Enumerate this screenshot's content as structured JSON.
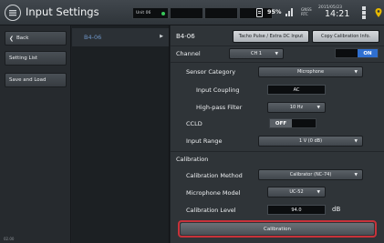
{
  "header": {
    "title": "Input Settings",
    "unit_label": "Unit 06",
    "battery": "95%",
    "gps_top": "GNSS",
    "gps_bottom": "RTC",
    "date": "2015/05/23",
    "time": "14:21"
  },
  "left_nav": {
    "back_label": "Back",
    "items": [
      "Setting List",
      "Save and Load"
    ],
    "version": "02.00"
  },
  "middle": {
    "selected_item": "B4-06"
  },
  "panel": {
    "title": "B4-06",
    "tacho_button": "Tacho Pulse / Extra DC Input",
    "copy_button": "Copy Calibration Info.",
    "channel_label": "Channel",
    "channel_value": "CH 1",
    "channel_toggle": "ON",
    "sensor_category_label": "Sensor Category",
    "sensor_category_value": "Microphone",
    "input_coupling_label": "Input Coupling",
    "input_coupling_value": "AC",
    "highpass_label": "High-pass Filter",
    "highpass_value": "10 Hz",
    "ccld_label": "CCLD",
    "ccld_value": "OFF",
    "input_range_label": "Input Range",
    "input_range_value": "1 V (0 dB)",
    "calibration_section": "Calibration",
    "cal_method_label": "Calibration Method",
    "cal_method_value": "Calibrator  (NC-74)",
    "mic_model_label": "Microphone Model",
    "mic_model_value": "UC-52",
    "cal_level_label": "Calibration Level",
    "cal_level_value": "94.0",
    "cal_level_unit": "dB",
    "calibration_button": "Calibration"
  },
  "colors": {
    "accent_green": "#38c75a",
    "toggle_on": "#2f6fd0",
    "highlight_red": "#c8323a",
    "list_blue": "#6e95c7"
  }
}
